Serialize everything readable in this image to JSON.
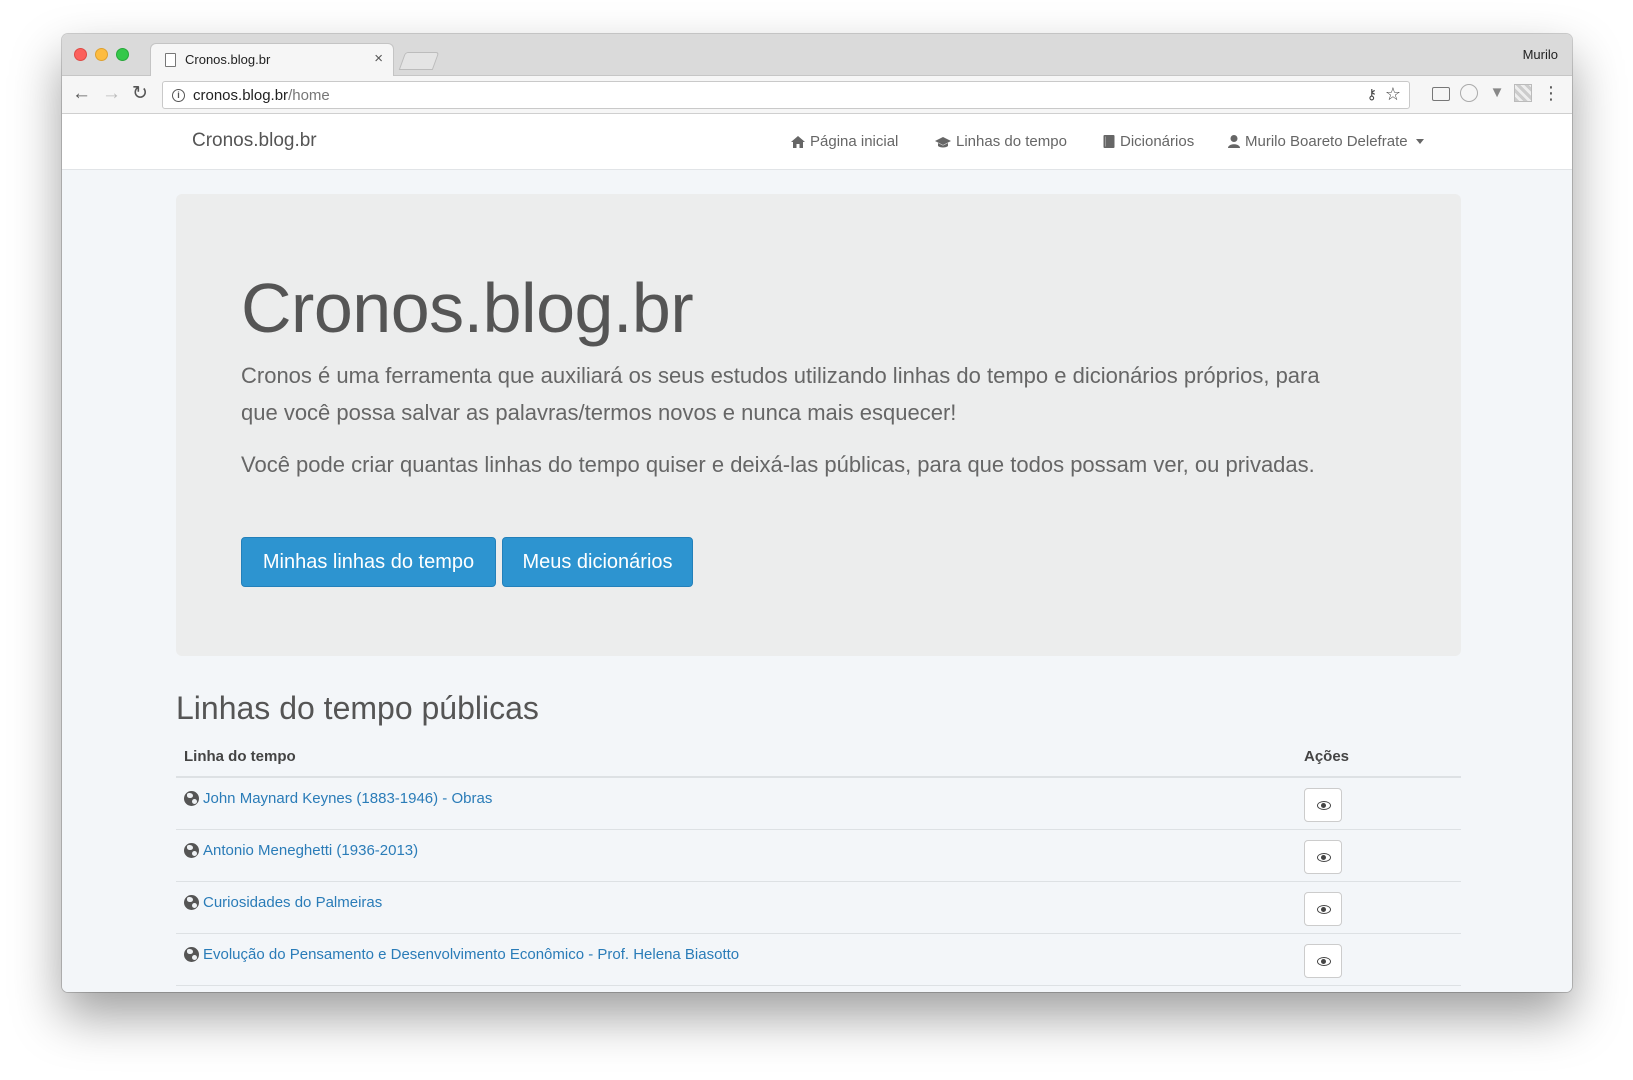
{
  "browser": {
    "tab_title": "Cronos.blog.br",
    "tab_close": "×",
    "profile_name": "Murilo",
    "url_host": "cronos.blog.br",
    "url_path": "/home",
    "icons": {
      "back": "←",
      "forward": "→",
      "reload": "↻",
      "info": "i",
      "key": "⚷",
      "star": "☆",
      "menu": "⋮"
    }
  },
  "navbar": {
    "brand": "Cronos.blog.br",
    "items": [
      {
        "label": "Página inicial",
        "icon": "home-icon"
      },
      {
        "label": "Linhas do tempo",
        "icon": "graduation-cap-icon"
      },
      {
        "label": "Dicionários",
        "icon": "book-icon"
      },
      {
        "label": "Murilo Boareto Delefrate",
        "icon": "user-icon"
      }
    ]
  },
  "hero": {
    "title": "Cronos.blog.br",
    "paragraph1": "Cronos é uma ferramenta que auxiliará os seus estudos utilizando linhas do tempo e dicionários próprios, para que você possa salvar as palavras/termos novos e nunca mais esquecer!",
    "paragraph2": "Você pode criar quantas linhas do tempo quiser e deixá-las públicas, para que todos possam ver, ou privadas.",
    "btn_timelines": "Minhas linhas do tempo",
    "btn_dictionaries": "Meus dicionários"
  },
  "public_timelines": {
    "title": "Linhas do tempo públicas",
    "col_timeline": "Linha do tempo",
    "col_actions": "Ações",
    "rows": [
      {
        "name": "John Maynard Keynes (1883-1946) - Obras"
      },
      {
        "name": "Antonio Meneghetti (1936-2013)"
      },
      {
        "name": "Curiosidades do Palmeiras"
      },
      {
        "name": "Evolução do Pensamento e Desenvolvimento Econômico - Prof. Helena Biasotto"
      }
    ]
  },
  "colors": {
    "primary": "#2d94d0",
    "link": "#2a7cb8",
    "jumbotron_bg": "#eceded",
    "page_bg": "#f3f6f9"
  }
}
